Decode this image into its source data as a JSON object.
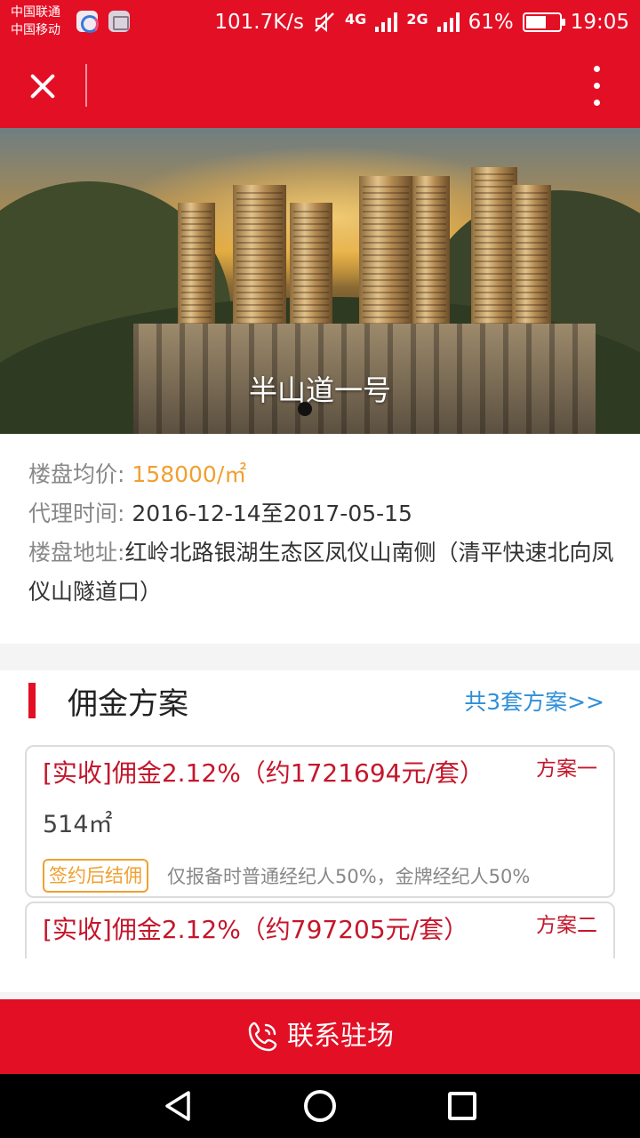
{
  "status_bar": {
    "carrier_1": "中国联通",
    "carrier_2": "中国移动",
    "net_speed": "101.7K/s",
    "net_type_1": "4G",
    "net_type_2": "2G",
    "battery": "61%",
    "battery_level": 0.61,
    "time": "19:05"
  },
  "banner": {
    "title": "半山道一号",
    "slide_count": 1,
    "active_slide": 1
  },
  "property": {
    "price_label": "楼盘均价:",
    "price_value": "158000/㎡",
    "agency_label": "代理时间:",
    "agency_value": "2016-12-14至2017-05-15",
    "address_label": "楼盘地址:",
    "address_value": "红岭北路银湖生态区凤仪山南侧（清平快速北向凤仪山隧道口）"
  },
  "commission": {
    "title": "佣金方案",
    "more_link": "共3套方案>>",
    "plans": [
      {
        "title": "[实收]佣金2.12%（约1721694元/套）",
        "tag": "方案一",
        "area": "514㎡",
        "badge": "签约后结佣",
        "note": "仅报备时普通经纪人50%，金牌经纪人50%"
      },
      {
        "title": "[实收]佣金2.12%（约797205元/套）",
        "tag": "方案二"
      }
    ]
  },
  "contact_button": {
    "label": "联系驻场"
  },
  "colors": {
    "brand_red": "#e30f25",
    "price_orange": "#f0a030",
    "link_blue": "#2f8fd8",
    "plan_red": "#c4172c"
  }
}
